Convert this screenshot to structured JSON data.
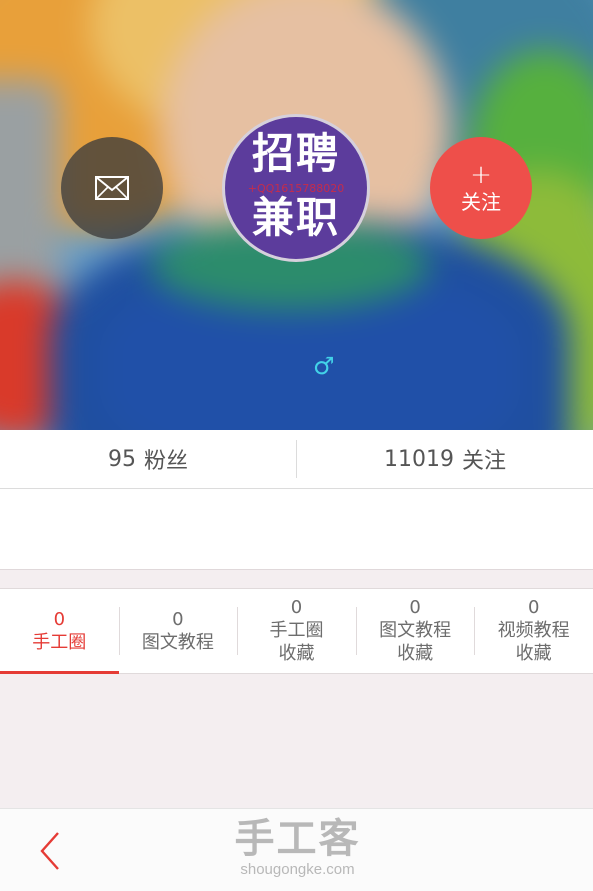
{
  "profile": {
    "avatar_line1": "招聘",
    "avatar_line2": "兼职",
    "avatar_qq": "+QQ1615788020",
    "gender_symbol": "♂",
    "follow_plus": "+",
    "follow_label": "关注",
    "mail_icon": "envelope-icon"
  },
  "stats": {
    "fans_count": "95",
    "fans_label": "粉丝",
    "following_count": "11019",
    "following_label": "关注"
  },
  "tabs": [
    {
      "count": "0",
      "label": "手工圈",
      "active": true
    },
    {
      "count": "0",
      "label": "图文教程",
      "active": false
    },
    {
      "count": "0",
      "label": "手工圈\n收藏",
      "active": false
    },
    {
      "count": "0",
      "label": "图文教程\n收藏",
      "active": false
    },
    {
      "count": "0",
      "label": "视频教程\n收藏",
      "active": false
    }
  ],
  "bottom_bar": {
    "back_icon": "chevron-left-icon",
    "logo_cn": "手工客",
    "logo_en": "shougongke.com"
  },
  "colors": {
    "accent": "#e53b35",
    "follow_button": "#ee4f4a",
    "gender_icon": "#42d2e8",
    "avatar_bg": "#5c3c9c"
  }
}
